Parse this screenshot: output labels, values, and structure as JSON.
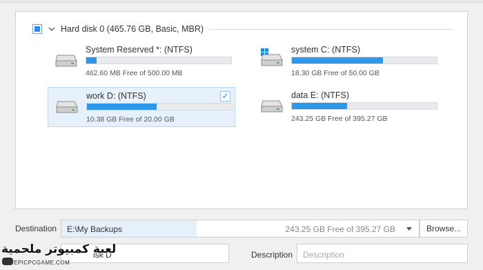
{
  "disk": {
    "title": "Hard disk 0 (465.76 GB, Basic, MBR)",
    "checkbox_state": "partial",
    "expanded": true
  },
  "partitions": [
    {
      "name": "System Reserved *: (NTFS)",
      "free": "462.60 MB Free of 500.00 MB",
      "used_fraction": 0.07,
      "icon": "drive-icon",
      "selected": false
    },
    {
      "name": "system C: (NTFS)",
      "free": "18.30 GB Free of 50.00 GB",
      "used_fraction": 0.63,
      "icon": "windows-drive-icon",
      "selected": false
    },
    {
      "name": "work D: (NTFS)",
      "free": "10.38 GB Free of 20.00 GB",
      "used_fraction": 0.48,
      "icon": "drive-icon",
      "selected": true
    },
    {
      "name": "data E: (NTFS)",
      "free": "243.25 GB Free of 395.27 GB",
      "used_fraction": 0.38,
      "icon": "drive-icon",
      "selected": false
    }
  ],
  "destination": {
    "label": "Destination",
    "path": "E:\\My Backups",
    "free": "243.25 GB Free of 395.27 GB",
    "browse_label": "Browse..."
  },
  "task": {
    "name_value": "Disk D",
    "name_visible": "isk D",
    "description_label": "Description",
    "description_placeholder": "Description"
  },
  "watermark": {
    "arabic": "لعبة كمبيوتر ملحمية",
    "latin": "EPICPCGAME.COM"
  },
  "colors": {
    "accent": "#2f97e8",
    "selection": "#e6f1fb",
    "check": "#1e88e5"
  }
}
